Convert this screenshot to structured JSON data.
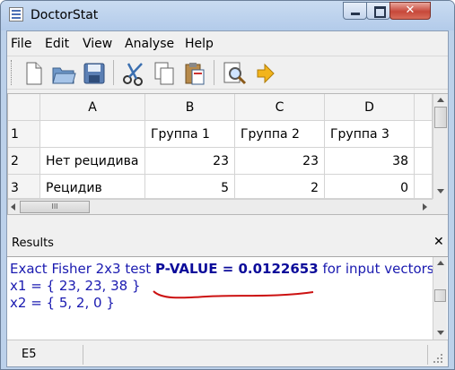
{
  "window": {
    "title": "DoctorStat",
    "close_glyph": "✕"
  },
  "menu": [
    "File",
    "Edit",
    "View",
    "Analyse",
    "Help"
  ],
  "toolbar": [
    {
      "name": "new-file-icon"
    },
    {
      "name": "open-folder-icon"
    },
    {
      "name": "save-disk-icon"
    },
    {
      "name": "cut-scissors-icon"
    },
    {
      "name": "copy-icon"
    },
    {
      "name": "paste-icon"
    },
    {
      "name": "preview-search-icon"
    },
    {
      "name": "arrow-right-icon"
    }
  ],
  "sheet": {
    "columns": [
      "A",
      "B",
      "C",
      "D"
    ],
    "rows": [
      {
        "num": "1",
        "cells": [
          "",
          "Группа 1",
          "Группа 2",
          "Группа 3"
        ]
      },
      {
        "num": "2",
        "cells": [
          "Нет рецидива",
          "23",
          "23",
          "38"
        ]
      },
      {
        "num": "3",
        "cells": [
          "Рецидив",
          "5",
          "2",
          "0"
        ]
      }
    ],
    "hscroll_grip": "III"
  },
  "results_panel": {
    "title": "Results",
    "close_glyph": "✕",
    "line1_prefix": "Exact Fisher 2x3 test",
    "line1_bold": "P-VALUE = 0.0122653",
    "line1_suffix": "for input vectors:",
    "line2": "x1 = { 23, 23, 38 }",
    "line3": "x2 = { 5, 2, 0 }",
    "underline_color": "#cc1111"
  },
  "statusbar": {
    "cell": "E5"
  },
  "colors": {
    "result_text": "#1a1ab0",
    "title_bar": "#bcd1ea",
    "close_button": "#c7483a"
  }
}
